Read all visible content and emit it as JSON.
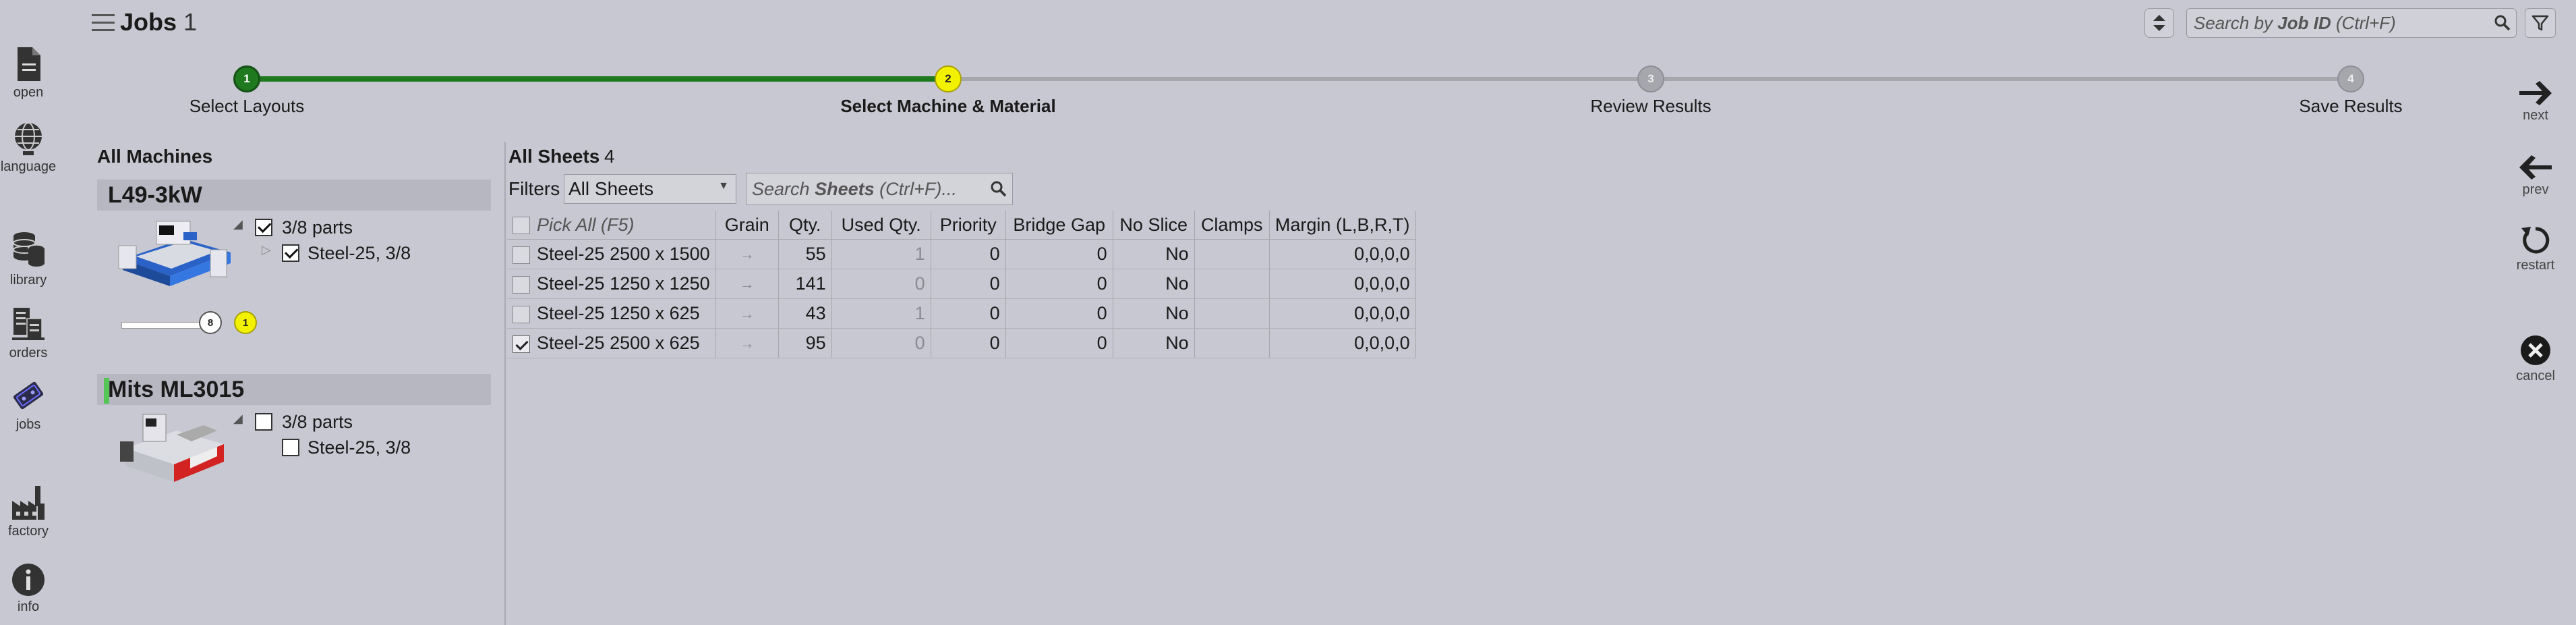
{
  "nav": {
    "items": [
      {
        "label": "open",
        "icon": "open-file-icon"
      },
      {
        "label": "language",
        "icon": "globe-icon"
      },
      {
        "label": "library",
        "icon": "database-icon"
      },
      {
        "label": "orders",
        "icon": "orders-icon"
      },
      {
        "label": "jobs",
        "icon": "jobs-icon",
        "active": true
      },
      {
        "label": "factory",
        "icon": "factory-icon"
      },
      {
        "label": "info",
        "icon": "info-icon"
      }
    ]
  },
  "header": {
    "title": "Jobs",
    "count": "1",
    "search": {
      "prefix": "Search by ",
      "bold": "Job ID",
      "suffix": " (Ctrl+F)"
    }
  },
  "stepper": {
    "steps": [
      {
        "number": "1",
        "label": "Select Layouts",
        "state": "done"
      },
      {
        "number": "2",
        "label": "Select Machine & Material",
        "state": "current"
      },
      {
        "number": "3",
        "label": "Review Results",
        "state": "todo"
      },
      {
        "number": "4",
        "label": "Save Results",
        "state": "todo"
      }
    ],
    "colors": {
      "done": "#1f7a1f",
      "current": "#f2f200",
      "todo": "#a6a6ad"
    }
  },
  "actions": {
    "next": "next",
    "prev": "prev",
    "restart": "restart",
    "cancel": "cancel"
  },
  "machines": {
    "header": "All Machines",
    "list": [
      {
        "name": "L49-3kW",
        "parts": "3/8 parts",
        "parts_checked": true,
        "material": "Steel-25, 3/8",
        "material_checked": true,
        "slider_value": "8",
        "slider_badge": "1"
      },
      {
        "name": "Mits ML3015",
        "parts": "3/8 parts",
        "parts_checked": false,
        "material": "Steel-25, 3/8",
        "material_checked": false
      }
    ]
  },
  "sheets": {
    "title": "All Sheets",
    "count": "4",
    "filters_label": "Filters",
    "filter_value": "All Sheets",
    "search": {
      "prefix": "Search ",
      "bold": "Sheets",
      "suffix": " (Ctrl+F)..."
    },
    "columns": {
      "pick": "Pick All (F5)",
      "grain": "Grain",
      "qty": "Qty.",
      "used": "Used Qty.",
      "priority": "Priority",
      "bridge": "Bridge Gap",
      "noslice": "No Slice",
      "clamps": "Clamps",
      "margin": "Margin (L,B,R,T)"
    },
    "rows": [
      {
        "name": "Steel-25 2500 x 1500",
        "grain": "→",
        "qty": "55",
        "used": "1",
        "priority": "0",
        "bridge": "0",
        "noslice": "No",
        "clamps": "",
        "margin": "0,0,0,0",
        "checked": false
      },
      {
        "name": "Steel-25 1250 x 1250",
        "grain": "→",
        "qty": "141",
        "used": "0",
        "priority": "0",
        "bridge": "0",
        "noslice": "No",
        "clamps": "",
        "margin": "0,0,0,0",
        "checked": false
      },
      {
        "name": "Steel-25 1250 x 625",
        "grain": "→",
        "qty": "43",
        "used": "1",
        "priority": "0",
        "bridge": "0",
        "noslice": "No",
        "clamps": "",
        "margin": "0,0,0,0",
        "checked": false
      },
      {
        "name": "Steel-25 2500 x 625",
        "grain": "→",
        "qty": "95",
        "used": "0",
        "priority": "0",
        "bridge": "0",
        "noslice": "No",
        "clamps": "",
        "margin": "0,0,0,0",
        "checked": true
      }
    ]
  }
}
